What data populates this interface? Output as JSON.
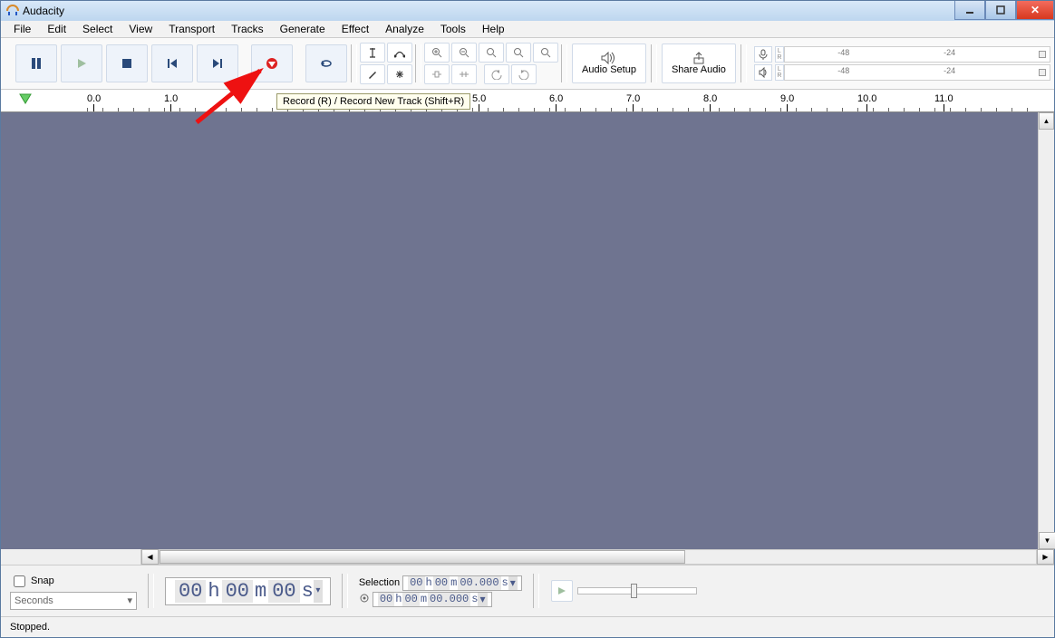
{
  "window": {
    "title": "Audacity"
  },
  "menu": [
    "File",
    "Edit",
    "Select",
    "View",
    "Transport",
    "Tracks",
    "Generate",
    "Effect",
    "Analyze",
    "Tools",
    "Help"
  ],
  "tooltip": "Record (R) / Record New Track (Shift+R)",
  "toolbar": {
    "audio_setup": "Audio Setup",
    "share_audio": "Share Audio"
  },
  "meter": {
    "m48": "-48",
    "m24": "-24",
    "lr_l": "L",
    "lr_r": "R"
  },
  "ruler": [
    "0.0",
    "1.0",
    "5.0",
    "6.0",
    "7.0",
    "8.0",
    "9.0",
    "10.0",
    "11.0"
  ],
  "snap": {
    "label": "Snap",
    "unit": "Seconds"
  },
  "time_main": {
    "h1": "00",
    "h_label": "h",
    "m1": "00",
    "m_label": "m",
    "s1": "00",
    "s_label": "s"
  },
  "selection": {
    "label": "Selection",
    "start": {
      "h": "00",
      "hL": "h",
      "m": "00",
      "mL": "m",
      "s": "00.000",
      "sL": "s"
    },
    "end": {
      "h": "00",
      "hL": "h",
      "m": "00",
      "mL": "m",
      "s": "00.000",
      "sL": "s"
    }
  },
  "status": "Stopped."
}
